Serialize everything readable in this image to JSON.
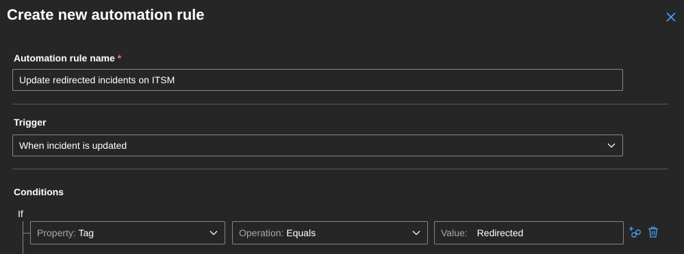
{
  "dialog": {
    "title": "Create new automation rule"
  },
  "name_section": {
    "label": "Automation rule name",
    "required_mark": "*",
    "value": "Update redirected incidents on ITSM"
  },
  "trigger_section": {
    "label": "Trigger",
    "selected": "When incident is updated"
  },
  "conditions_section": {
    "label": "Conditions",
    "if_label": "If",
    "row": {
      "property_key": "Property:",
      "property_value": "Tag",
      "operation_key": "Operation:",
      "operation_value": "Equals",
      "value_key": "Value:",
      "value_value": "Redirected"
    }
  },
  "icons": {
    "close": "close-icon",
    "add_condition": "add-condition-icon",
    "delete": "trash-icon",
    "dropdown": "chevron-down-icon"
  },
  "colors": {
    "background": "#262626",
    "border": "#8a8886",
    "accent": "#4da3ff",
    "required": "#f1707b"
  }
}
